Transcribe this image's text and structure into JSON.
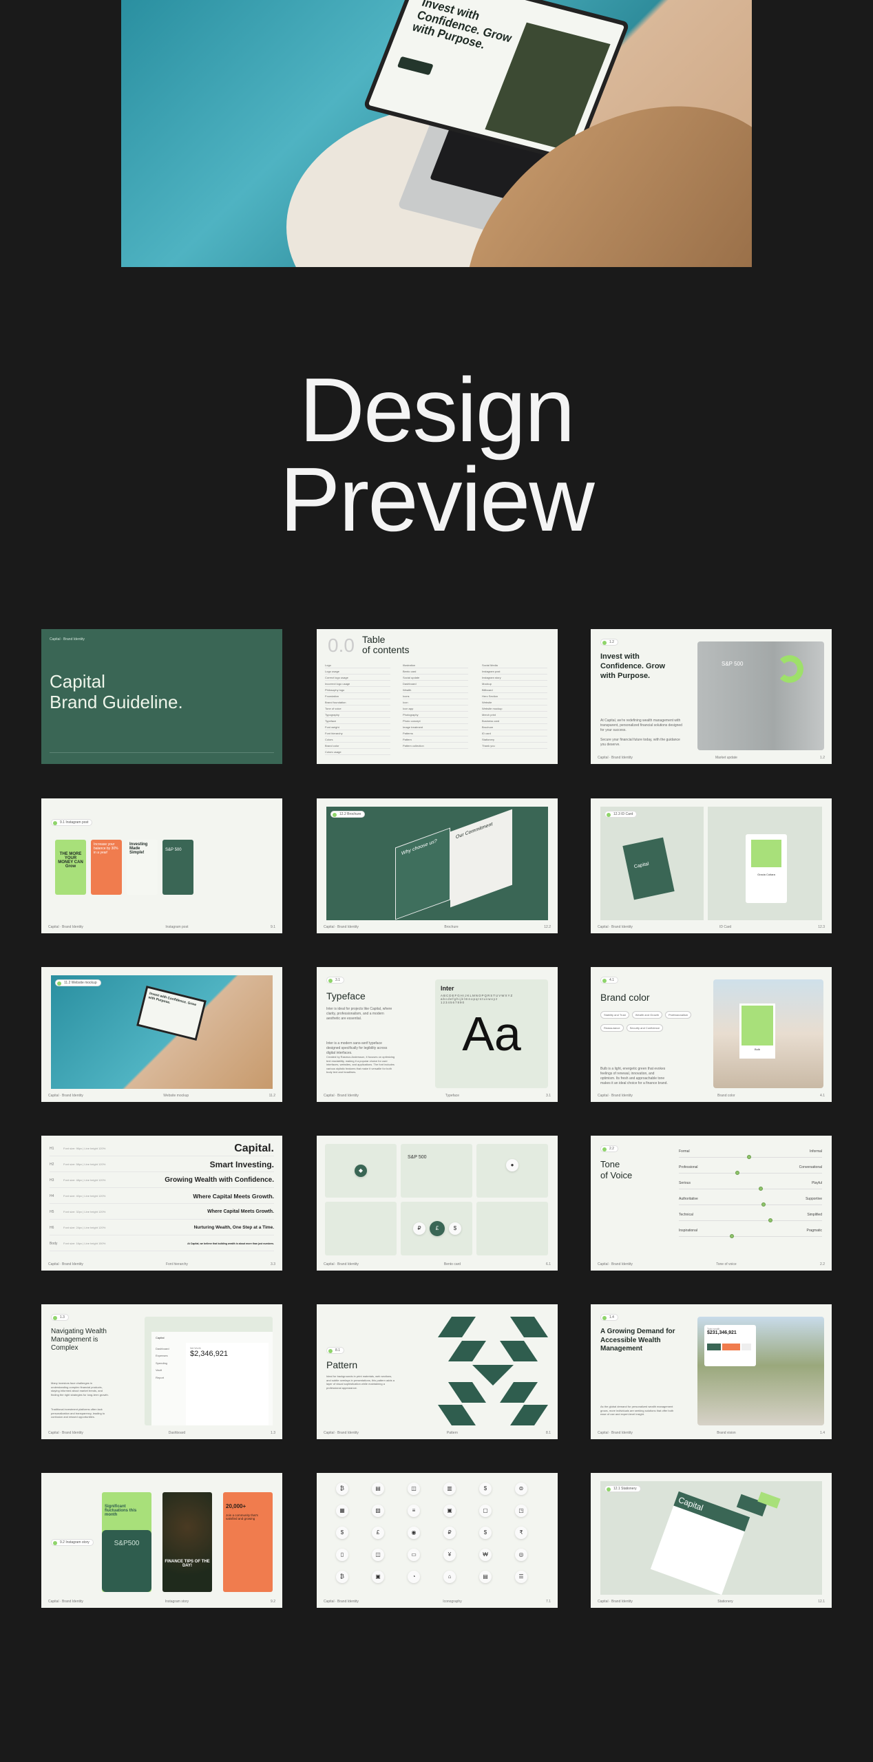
{
  "hero": {
    "laptop_headline": "Invest with Confidence. Grow with Purpose."
  },
  "title": {
    "line1": "Design",
    "line2": "Preview"
  },
  "footer_brand": "Capital · Brand Identity",
  "colors": {
    "background": "#1a1a1a",
    "brand_green": "#3a6655",
    "accent_lime": "#a8e07a",
    "accent_orange": "#f07c4e",
    "slide_bg": "#f3f5f0"
  },
  "slides": {
    "cover": {
      "title_line1": "Capital",
      "title_line2": "Brand Guideline.",
      "brand": "Capital · Brand Identity"
    },
    "toc": {
      "number": "0.0",
      "title_line1": "Table",
      "title_line2": "of contents",
      "col1": [
        "Logo",
        "Logo usage",
        "Correct logo usage",
        "Incorrect logo usage",
        "Philosophy logo",
        "Foundation",
        "Brand foundation",
        "Tone of voice",
        "Typography",
        "Typeface",
        "Font weight",
        "Font hierarchy",
        "Colors",
        "Brand color",
        "Colors usage"
      ],
      "col2": [
        "Illustration",
        "Bento card",
        "Social update",
        "Dashboard",
        "Wealth",
        "Icons",
        "Icon",
        "Icon app",
        "Photography",
        "Photo concept",
        "Image treatment",
        "Patterns",
        "Pattern",
        "Pattern collection"
      ],
      "col3": [
        "Social Media",
        "Instagram post",
        "Instagram story",
        "Mockup",
        "Billboard",
        "Hero Section",
        "Website",
        "Website mockup",
        "Merch print",
        "Business card",
        "Brochure",
        "ID card",
        "Stationery",
        "Thank you"
      ]
    },
    "invest": {
      "badge": "1.2",
      "heading": "Invest with Confidence. Grow with Purpose.",
      "body1": "At Capital, we're redefining wealth management with transparent, personalized financial solutions designed for your success.",
      "body2": "Secure your financial future today, with the guidance you deserve.",
      "overlay": "S&P 500",
      "footer_label": "Market update"
    },
    "instagram_post": {
      "badge": "9.1 Instagram post",
      "post1": "THE MORE YOUR MONEY CAN Grow",
      "post2": "Increase your balance by 30% in a year!",
      "post3": "Investing Made Simple!",
      "post4": "S&P 500",
      "footer_label": "Instagram post",
      "page": "9.1"
    },
    "brochure": {
      "badge": "12.2 Brochure",
      "left_page": "Why choose us?",
      "right_page": "Our Commitment",
      "footer_label": "Brochure",
      "page": "12.2"
    },
    "id_card": {
      "badge": "12.3 ID Card",
      "brand": "Capital",
      "name": "Gracia Cutiara",
      "footer_label": "ID Card",
      "page": "12.3"
    },
    "website_mockup": {
      "badge": "11.2 Website mockup",
      "headline": "Invest with Confidence. Grow with Purpose.",
      "footer_label": "Website mockup"
    },
    "typeface": {
      "badge": "3.1",
      "heading": "Typeface",
      "body1": "Inter is ideal for projects like Capital, where clarity, professionalism, and a modern aesthetic are essential.",
      "body2": "Inter is a modern sans-serif typeface designed specifically for legibility across digital interfaces.",
      "body3": "Created by Rasmus Andersson, it focuses on optimizing text readability, making it a popular choice for user interfaces, websites, and applications. The font includes various stylistic features that make it versatile for both body text and headlines.",
      "font_name": "Inter",
      "upper": "ABCDEFGHIJKLMNOPQRSTUVWXYZ",
      "lower": "abcdefghijklmnopqrstuvwxyz",
      "digits": "1234567890",
      "sample": "Aa",
      "footer_label": "Typeface",
      "page": "3.1"
    },
    "brand_color": {
      "badge": "4.1",
      "heading": "Brand color",
      "tags": [
        "Stability and Trust",
        "Wealth and Growth",
        "Professionalism",
        "Reassurance",
        "Security and Confidence"
      ],
      "body": "Bulb is a light, energetic green that evokes feelings of renewal, innovation, and optimism. Its fresh and approachable tone makes it an ideal choice for a finance brand.",
      "swatch_name": "Bulb",
      "swatch_color": "#a8e07a",
      "footer_label": "Brand color",
      "page": "4.1"
    },
    "font_hierarchy": {
      "rows": [
        {
          "level": "H1",
          "spec": "Font size: 96px | Line height 120%",
          "sample": "Capital."
        },
        {
          "level": "H2",
          "spec": "Font size: 58px | Line height 120%",
          "sample": "Smart Investing."
        },
        {
          "level": "H3",
          "spec": "Font size: 48px | Line height 120%",
          "sample": "Growing Wealth with Confidence."
        },
        {
          "level": "H4",
          "spec": "Font size: 40px | Line height 120%",
          "sample": "Where Capital Meets Growth."
        },
        {
          "level": "H5",
          "spec": "Font size: 32px | Line height 120%",
          "sample": "Where Capital Meets Growth."
        },
        {
          "level": "H6",
          "spec": "Font size: 24px | Line height 120%",
          "sample": "Nurturing Wealth, One Step at a Time."
        },
        {
          "level": "Body",
          "spec": "Font size: 16px | Line height 150%",
          "sample": "At Capital, we believe that building wealth is about more than just numbers."
        }
      ],
      "footer_label": "Font hierarchy",
      "page": "3.3"
    },
    "bento": {
      "overlay": "S&P 500",
      "currency": [
        "₽",
        "£",
        "$"
      ],
      "footer_label": "Bento card",
      "page": "6.1"
    },
    "tone": {
      "badge": "2.2",
      "heading_line1": "Tone",
      "heading_line2": "of Voice",
      "scales": [
        {
          "left": "Formal",
          "right": "Informal",
          "value": 0.49
        },
        {
          "left": "Professional",
          "right": "Conversational",
          "value": 0.41
        },
        {
          "left": "Serious",
          "right": "Playful",
          "value": 0.57
        },
        {
          "left": "Authoritative",
          "right": "Supportive",
          "value": 0.59
        },
        {
          "left": "Technical",
          "right": "Simplified",
          "value": 0.64
        },
        {
          "left": "Inspirational",
          "right": "Pragmatic",
          "value": 0.37
        }
      ],
      "footer_label": "Tone of voice",
      "page": "2.2"
    },
    "dashboard": {
      "badge": "1.3",
      "heading": "Navigating Wealth Management is Complex",
      "body1": "Many investors face challenges in understanding complex financial products, staying informed about market trends, and finding the right strategies for long-term growth.",
      "body2": "Traditional investment platforms often lack personalization and transparency, leading to confusion and missed opportunities.",
      "app_brand": "Capital",
      "nav": [
        "Dashboard",
        "Expenses",
        "Spending",
        "Vault",
        "Report"
      ],
      "net_worth_label": "Net Worth",
      "net_worth": "$2,346,921",
      "footer_label": "Dashboard",
      "page": "1.3"
    },
    "pattern": {
      "badge": "8.1",
      "heading": "Pattern",
      "body": "Ideal for backgrounds in print materials, web sections, and subtle overlays in presentations, this pattern adds a layer of visual sophistication while maintaining a professional appearance.",
      "footer_label": "Pattern",
      "page": "8.1"
    },
    "demand": {
      "badge": "1.4",
      "heading": "A Growing Demand for Accessible Wealth Management",
      "body": "As the global demand for personalized wealth management grows, more individuals are seeking solutions that offer both ease of use and expert-level insight.",
      "card_label": "Total wealth",
      "card_value": "$231,346,921",
      "footer_label": "Brand vision",
      "page": "1.4"
    },
    "stories": {
      "badge": "9.2 Instagram story",
      "story1_text": "Significant fluctuations this month",
      "story1_value": "S&P500",
      "story2_text": "FINANCE TIPS OF THE DAY!",
      "story3_value": "20,000+",
      "story3_text": "Join a community that's satisfied and growing",
      "footer_label": "Instagram story",
      "page": "9.2"
    },
    "icons": {
      "glyphs": [
        "₿",
        "▤",
        "◫",
        "▥",
        "$",
        "⊜",
        "▦",
        "▨",
        "≡",
        "▣",
        "▢",
        "◳",
        "$",
        "£",
        "◉",
        "₽",
        "$",
        "₹",
        "▯",
        "◫",
        "▭",
        "¥",
        "₩",
        "◎",
        "₿",
        "▣",
        "◔",
        "⌂",
        "▤",
        "☰"
      ],
      "footer_label": "Iconography",
      "page": "7.1"
    },
    "stationery": {
      "badge": "12.1 Stationery",
      "brand": "Capital",
      "footer_label": "Stationery",
      "page": "12.1"
    }
  }
}
